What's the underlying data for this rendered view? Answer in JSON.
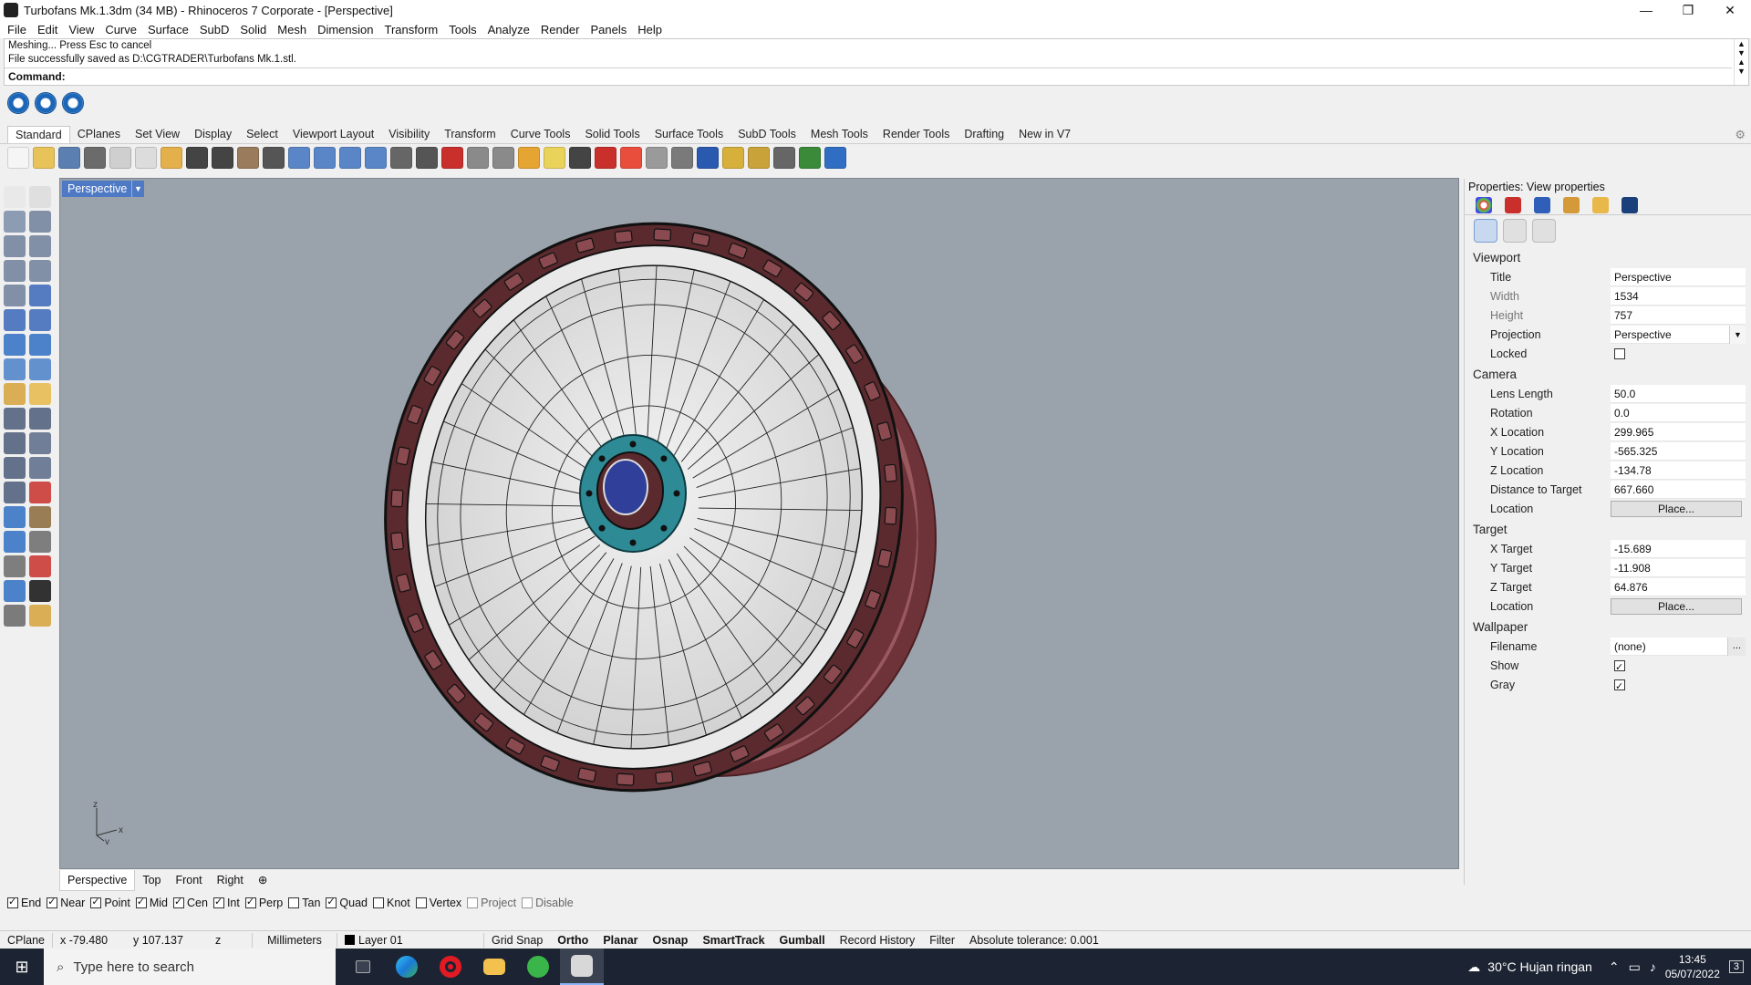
{
  "window": {
    "title": "Turbofans Mk.1.3dm (34 MB) - Rhinoceros 7 Corporate - [Perspective]",
    "minimize": "—",
    "restore": "❐",
    "close": "✕"
  },
  "menu": [
    "File",
    "Edit",
    "View",
    "Curve",
    "Surface",
    "SubD",
    "Solid",
    "Mesh",
    "Dimension",
    "Transform",
    "Tools",
    "Analyze",
    "Render",
    "Panels",
    "Help"
  ],
  "command": {
    "history": [
      "Meshing... Press Esc to cancel",
      "File successfully saved as D:\\CGTRADER\\Turbofans Mk.1.stl."
    ],
    "prompt": "Command:"
  },
  "toolbar_tabs": [
    "Standard",
    "CPlanes",
    "Set View",
    "Display",
    "Select",
    "Viewport Layout",
    "Visibility",
    "Transform",
    "Curve Tools",
    "Solid Tools",
    "Surface Tools",
    "SubD Tools",
    "Mesh Tools",
    "Render Tools",
    "Drafting",
    "New in V7"
  ],
  "toolbar_icon_colors": [
    "#f5f5f5",
    "#e8c35a",
    "#5a7fb0",
    "#6b6b6b",
    "#cfcfcf",
    "#dcdcdc",
    "#e3b04b",
    "#444444",
    "#444444",
    "#9a7b5c",
    "#555555",
    "#5a86c8",
    "#5a86c8",
    "#5a86c8",
    "#5a86c8",
    "#666666",
    "#555555",
    "#c9302c",
    "#8a8a8a",
    "#8a8a8a",
    "#e6a532",
    "#e9d35a",
    "#444444",
    "#c9302c",
    "#e94d3c",
    "#9a9a9a",
    "#7a7a7a",
    "#2a5ab0",
    "#d6b03a",
    "#c9a23a",
    "#666666",
    "#3a8a3a",
    "#2f6ec2"
  ],
  "viewport": {
    "label": "Perspective",
    "tabs": [
      "Perspective",
      "Top",
      "Front",
      "Right"
    ],
    "add_tab": "⊕",
    "axes": {
      "x": "x",
      "y": "y",
      "z": "z"
    }
  },
  "osnaps": [
    {
      "label": "End",
      "checked": true
    },
    {
      "label": "Near",
      "checked": true
    },
    {
      "label": "Point",
      "checked": true
    },
    {
      "label": "Mid",
      "checked": true
    },
    {
      "label": "Cen",
      "checked": true
    },
    {
      "label": "Int",
      "checked": true
    },
    {
      "label": "Perp",
      "checked": true
    },
    {
      "label": "Tan",
      "checked": false
    },
    {
      "label": "Quad",
      "checked": true
    },
    {
      "label": "Knot",
      "checked": false
    },
    {
      "label": "Vertex",
      "checked": false
    },
    {
      "label": "Project",
      "checked": false,
      "disabled": true
    },
    {
      "label": "Disable",
      "checked": false,
      "disabled": true
    }
  ],
  "status": {
    "cplane": "CPlane",
    "x": "x -79.480",
    "y": "y 107.137",
    "z": "z",
    "units": "Millimeters",
    "layer": "Layer 01",
    "grid_snap": "Grid Snap",
    "ortho": "Ortho",
    "planar": "Planar",
    "osnap": "Osnap",
    "smarttrack": "SmartTrack",
    "gumball": "Gumball",
    "record_history": "Record History",
    "filter": "Filter",
    "tolerance": "Absolute tolerance: 0.001"
  },
  "properties": {
    "title": "Properties: View properties",
    "sections": {
      "viewport": "Viewport",
      "camera": "Camera",
      "target": "Target",
      "wallpaper": "Wallpaper"
    },
    "viewport": {
      "title_label": "Title",
      "title_value": "Perspective",
      "width_label": "Width",
      "width_value": "1534",
      "height_label": "Height",
      "height_value": "757",
      "projection_label": "Projection",
      "projection_value": "Perspective",
      "locked_label": "Locked"
    },
    "camera": {
      "lens_label": "Lens Length",
      "lens_value": "50.0",
      "rotation_label": "Rotation",
      "rotation_value": "0.0",
      "x_label": "X Location",
      "x_value": "299.965",
      "y_label": "Y Location",
      "y_value": "-565.325",
      "z_label": "Z Location",
      "z_value": "-134.78",
      "dist_label": "Distance to Target",
      "dist_value": "667.660",
      "loc_label": "Location",
      "loc_button": "Place..."
    },
    "target": {
      "x_label": "X Target",
      "x_value": "-15.689",
      "y_label": "Y Target",
      "y_value": "-11.908",
      "z_label": "Z Target",
      "z_value": "64.876",
      "loc_label": "Location",
      "loc_button": "Place..."
    },
    "wallpaper": {
      "filename_label": "Filename",
      "filename_value": "(none)",
      "browse": "...",
      "show_label": "Show",
      "gray_label": "Gray"
    }
  },
  "taskbar": {
    "search_placeholder": "Type here to search",
    "weather": "30°C  Hujan ringan",
    "time": "13:45",
    "date": "05/07/2022",
    "notifications": "3"
  }
}
